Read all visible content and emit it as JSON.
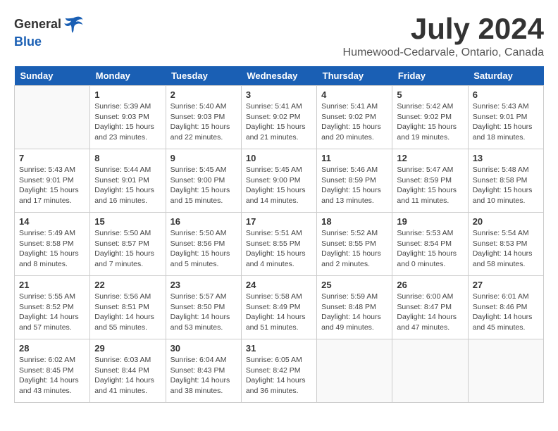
{
  "header": {
    "logo_general": "General",
    "logo_blue": "Blue",
    "month_year": "July 2024",
    "location": "Humewood-Cedarvale, Ontario, Canada"
  },
  "weekdays": [
    "Sunday",
    "Monday",
    "Tuesday",
    "Wednesday",
    "Thursday",
    "Friday",
    "Saturday"
  ],
  "weeks": [
    [
      {
        "day": "",
        "info": ""
      },
      {
        "day": "1",
        "info": "Sunrise: 5:39 AM\nSunset: 9:03 PM\nDaylight: 15 hours\nand 23 minutes."
      },
      {
        "day": "2",
        "info": "Sunrise: 5:40 AM\nSunset: 9:03 PM\nDaylight: 15 hours\nand 22 minutes."
      },
      {
        "day": "3",
        "info": "Sunrise: 5:41 AM\nSunset: 9:02 PM\nDaylight: 15 hours\nand 21 minutes."
      },
      {
        "day": "4",
        "info": "Sunrise: 5:41 AM\nSunset: 9:02 PM\nDaylight: 15 hours\nand 20 minutes."
      },
      {
        "day": "5",
        "info": "Sunrise: 5:42 AM\nSunset: 9:02 PM\nDaylight: 15 hours\nand 19 minutes."
      },
      {
        "day": "6",
        "info": "Sunrise: 5:43 AM\nSunset: 9:01 PM\nDaylight: 15 hours\nand 18 minutes."
      }
    ],
    [
      {
        "day": "7",
        "info": "Sunrise: 5:43 AM\nSunset: 9:01 PM\nDaylight: 15 hours\nand 17 minutes."
      },
      {
        "day": "8",
        "info": "Sunrise: 5:44 AM\nSunset: 9:01 PM\nDaylight: 15 hours\nand 16 minutes."
      },
      {
        "day": "9",
        "info": "Sunrise: 5:45 AM\nSunset: 9:00 PM\nDaylight: 15 hours\nand 15 minutes."
      },
      {
        "day": "10",
        "info": "Sunrise: 5:45 AM\nSunset: 9:00 PM\nDaylight: 15 hours\nand 14 minutes."
      },
      {
        "day": "11",
        "info": "Sunrise: 5:46 AM\nSunset: 8:59 PM\nDaylight: 15 hours\nand 13 minutes."
      },
      {
        "day": "12",
        "info": "Sunrise: 5:47 AM\nSunset: 8:59 PM\nDaylight: 15 hours\nand 11 minutes."
      },
      {
        "day": "13",
        "info": "Sunrise: 5:48 AM\nSunset: 8:58 PM\nDaylight: 15 hours\nand 10 minutes."
      }
    ],
    [
      {
        "day": "14",
        "info": "Sunrise: 5:49 AM\nSunset: 8:58 PM\nDaylight: 15 hours\nand 8 minutes."
      },
      {
        "day": "15",
        "info": "Sunrise: 5:50 AM\nSunset: 8:57 PM\nDaylight: 15 hours\nand 7 minutes."
      },
      {
        "day": "16",
        "info": "Sunrise: 5:50 AM\nSunset: 8:56 PM\nDaylight: 15 hours\nand 5 minutes."
      },
      {
        "day": "17",
        "info": "Sunrise: 5:51 AM\nSunset: 8:55 PM\nDaylight: 15 hours\nand 4 minutes."
      },
      {
        "day": "18",
        "info": "Sunrise: 5:52 AM\nSunset: 8:55 PM\nDaylight: 15 hours\nand 2 minutes."
      },
      {
        "day": "19",
        "info": "Sunrise: 5:53 AM\nSunset: 8:54 PM\nDaylight: 15 hours\nand 0 minutes."
      },
      {
        "day": "20",
        "info": "Sunrise: 5:54 AM\nSunset: 8:53 PM\nDaylight: 14 hours\nand 58 minutes."
      }
    ],
    [
      {
        "day": "21",
        "info": "Sunrise: 5:55 AM\nSunset: 8:52 PM\nDaylight: 14 hours\nand 57 minutes."
      },
      {
        "day": "22",
        "info": "Sunrise: 5:56 AM\nSunset: 8:51 PM\nDaylight: 14 hours\nand 55 minutes."
      },
      {
        "day": "23",
        "info": "Sunrise: 5:57 AM\nSunset: 8:50 PM\nDaylight: 14 hours\nand 53 minutes."
      },
      {
        "day": "24",
        "info": "Sunrise: 5:58 AM\nSunset: 8:49 PM\nDaylight: 14 hours\nand 51 minutes."
      },
      {
        "day": "25",
        "info": "Sunrise: 5:59 AM\nSunset: 8:48 PM\nDaylight: 14 hours\nand 49 minutes."
      },
      {
        "day": "26",
        "info": "Sunrise: 6:00 AM\nSunset: 8:47 PM\nDaylight: 14 hours\nand 47 minutes."
      },
      {
        "day": "27",
        "info": "Sunrise: 6:01 AM\nSunset: 8:46 PM\nDaylight: 14 hours\nand 45 minutes."
      }
    ],
    [
      {
        "day": "28",
        "info": "Sunrise: 6:02 AM\nSunset: 8:45 PM\nDaylight: 14 hours\nand 43 minutes."
      },
      {
        "day": "29",
        "info": "Sunrise: 6:03 AM\nSunset: 8:44 PM\nDaylight: 14 hours\nand 41 minutes."
      },
      {
        "day": "30",
        "info": "Sunrise: 6:04 AM\nSunset: 8:43 PM\nDaylight: 14 hours\nand 38 minutes."
      },
      {
        "day": "31",
        "info": "Sunrise: 6:05 AM\nSunset: 8:42 PM\nDaylight: 14 hours\nand 36 minutes."
      },
      {
        "day": "",
        "info": ""
      },
      {
        "day": "",
        "info": ""
      },
      {
        "day": "",
        "info": ""
      }
    ]
  ]
}
